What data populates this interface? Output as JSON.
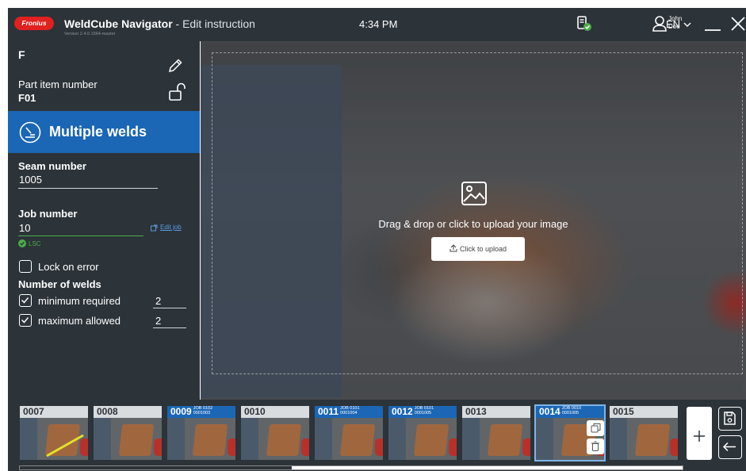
{
  "header": {
    "logo_text": "Fronius",
    "app_name": "WeldCube Navigator",
    "mode": " - Edit instruction",
    "version": "Version 2.4.0.1564-master",
    "time": "4:34 PM",
    "user_first": "John",
    "user_last": "Doe",
    "language": "EN"
  },
  "sidebar": {
    "code": "F",
    "part_item_label": "Part item number",
    "part_item_value": "F01",
    "weld_type": "Multiple welds",
    "seam_label": "Seam number",
    "seam_value": "1005",
    "job_label": "Job number",
    "job_value": "10",
    "edit_job_label": "Edit job",
    "job_status": "LSC",
    "lock_on_error_label": "Lock on error",
    "lock_on_error_checked": false,
    "num_welds_label": "Number of welds",
    "min_label": "minimum required",
    "min_value": "2",
    "min_checked": true,
    "max_label": "maximum allowed",
    "max_value": "2",
    "max_checked": true
  },
  "canvas": {
    "drag_text": "Drag & drop or click to upload your image",
    "upload_label": "Click to upload"
  },
  "filmstrip": {
    "thumbs": [
      {
        "seam": "0007",
        "job": "",
        "prog": "",
        "blue": false,
        "selected": false
      },
      {
        "seam": "0008",
        "job": "",
        "prog": "",
        "blue": false,
        "selected": false
      },
      {
        "seam": "0009",
        "job": "JOB 0102",
        "prog": "0001003",
        "blue": true,
        "selected": false
      },
      {
        "seam": "0010",
        "job": "",
        "prog": "",
        "blue": false,
        "selected": false
      },
      {
        "seam": "0011",
        "job": "JOB 0101",
        "prog": "0001004",
        "blue": true,
        "selected": false
      },
      {
        "seam": "0012",
        "job": "JOB 0101",
        "prog": "0001005",
        "blue": true,
        "selected": false
      },
      {
        "seam": "0013",
        "job": "",
        "prog": "",
        "blue": false,
        "selected": false
      },
      {
        "seam": "0014",
        "job": "JOB 0010",
        "prog": "0001005",
        "blue": true,
        "selected": true
      },
      {
        "seam": "0015",
        "job": "",
        "prog": "",
        "blue": false,
        "selected": false
      }
    ],
    "scroll_fraction_start": 0.0,
    "scroll_fraction_visible": 0.41
  },
  "colors": {
    "panel": "#2c3339",
    "accent_blue": "#1b66b5",
    "success_green": "#4cae48",
    "brand_red": "#e0211f"
  },
  "icons": [
    "pencil-icon",
    "unlock-icon",
    "weld-torch-icon",
    "image-icon",
    "upload-icon",
    "copy-icon",
    "trash-icon",
    "plus-icon",
    "save-icon",
    "back-arrow-icon",
    "device-status-icon",
    "user-icon",
    "chevron-down-icon",
    "minimize-icon",
    "close-icon",
    "external-link-icon",
    "check-circle-icon"
  ]
}
